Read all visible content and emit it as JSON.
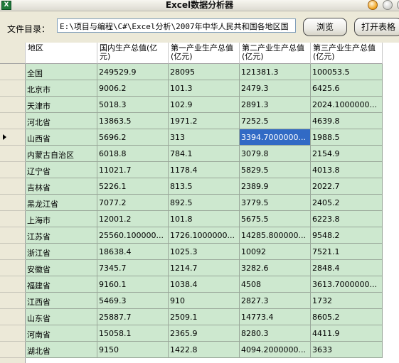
{
  "window": {
    "title": "Excel数据分析器",
    "icon": "excel-app-icon"
  },
  "toolbar": {
    "dir_label": "文件目录：",
    "dir_value": "E:\\项目与编程\\C#\\Excel分析\\2007年中华人民共和国各地区国",
    "browse_label": "浏览",
    "open_label": "打开表格"
  },
  "grid": {
    "columns": [
      "地区",
      "国内生产总值(亿元)",
      "第一产业生产总值(亿元)",
      "第二产业生产总值(亿元)",
      "第三产业生产总值(亿元)"
    ],
    "current_row": 4,
    "selected_cell": {
      "row": 4,
      "col": 3
    },
    "rows": [
      [
        "全国",
        "249529.9",
        "28095",
        "121381.3",
        "100053.5"
      ],
      [
        "北京市",
        "9006.2",
        "101.3",
        "2479.3",
        "6425.6"
      ],
      [
        "天津市",
        "5018.3",
        "102.9",
        "2891.3",
        "2024.1000000..."
      ],
      [
        "河北省",
        "13863.5",
        "1971.2",
        "7252.5",
        "4639.8"
      ],
      [
        "山西省",
        "5696.2",
        "313",
        "3394.7000000...",
        "1988.5"
      ],
      [
        "内蒙古自治区",
        "6018.8",
        "784.1",
        "3079.8",
        "2154.9"
      ],
      [
        "辽宁省",
        "11021.7",
        "1178.4",
        "5829.5",
        "4013.8"
      ],
      [
        "吉林省",
        "5226.1",
        "813.5",
        "2389.9",
        "2022.7"
      ],
      [
        "黑龙江省",
        "7077.2",
        "892.5",
        "3779.5",
        "2405.2"
      ],
      [
        "上海市",
        "12001.2",
        "101.8",
        "5675.5",
        "6223.8"
      ],
      [
        "江苏省",
        "25560.100000...",
        "1726.1000000...",
        "14285.800000...",
        "9548.2"
      ],
      [
        "浙江省",
        "18638.4",
        "1025.3",
        "10092",
        "7521.1"
      ],
      [
        "安徽省",
        "7345.7",
        "1214.7",
        "3282.6",
        "2848.4"
      ],
      [
        "福建省",
        "9160.1",
        "1038.4",
        "4508",
        "3613.7000000..."
      ],
      [
        "江西省",
        "5469.3",
        "910",
        "2827.3",
        "1732"
      ],
      [
        "山东省",
        "25887.7",
        "2509.1",
        "14773.4",
        "8605.2"
      ],
      [
        "河南省",
        "15058.1",
        "2365.9",
        "8280.3",
        "4411.9"
      ],
      [
        "湖北省",
        "9150",
        "1422.8",
        "4094.2000000...",
        "3633"
      ]
    ]
  }
}
